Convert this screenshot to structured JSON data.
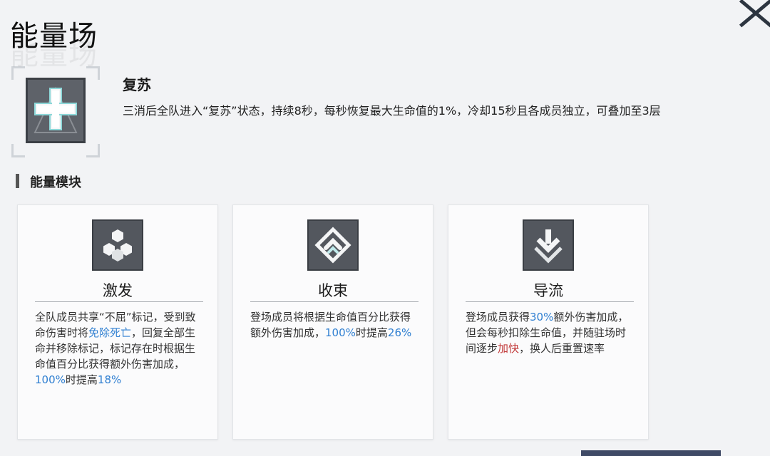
{
  "page": {
    "title": "能量场"
  },
  "close": {
    "icon": "close-icon"
  },
  "buff": {
    "icon": "cross-heal-icon",
    "name": "复苏",
    "description": "三消后全队进入“复苏”状态，持续8秒，每秒恢复最大生命值的1%，冷却15秒且各成员独立，可叠加至3层"
  },
  "section": {
    "title": "能量模块"
  },
  "cards": [
    {
      "icon": "hexagon-cluster-icon",
      "name": "激发",
      "desc_parts": [
        "全队成员共享“不屈”标记，受到致命伤害时将",
        "免除死亡",
        "，回复全部生命并移除标记，标记存在时根据生命值百分比获得额外伤害加成，",
        "100%",
        "时提高",
        "18%"
      ]
    },
    {
      "icon": "diamond-link-icon",
      "name": "收束",
      "desc_parts": [
        "登场成员将根据生命值百分比获得额外伤害加成，",
        "100%",
        "时提高",
        "26%"
      ]
    },
    {
      "icon": "download-chevron-icon",
      "name": "导流",
      "desc_parts": [
        "登场成员获得",
        "30%",
        "额外伤害加成，但会每秒扣除生命值，并随驻场时间逐步",
        "加快",
        "，换人后重置速率"
      ]
    }
  ],
  "colors": {
    "highlight_blue": "#2f7fd1",
    "highlight_red": "#c23b3b"
  }
}
